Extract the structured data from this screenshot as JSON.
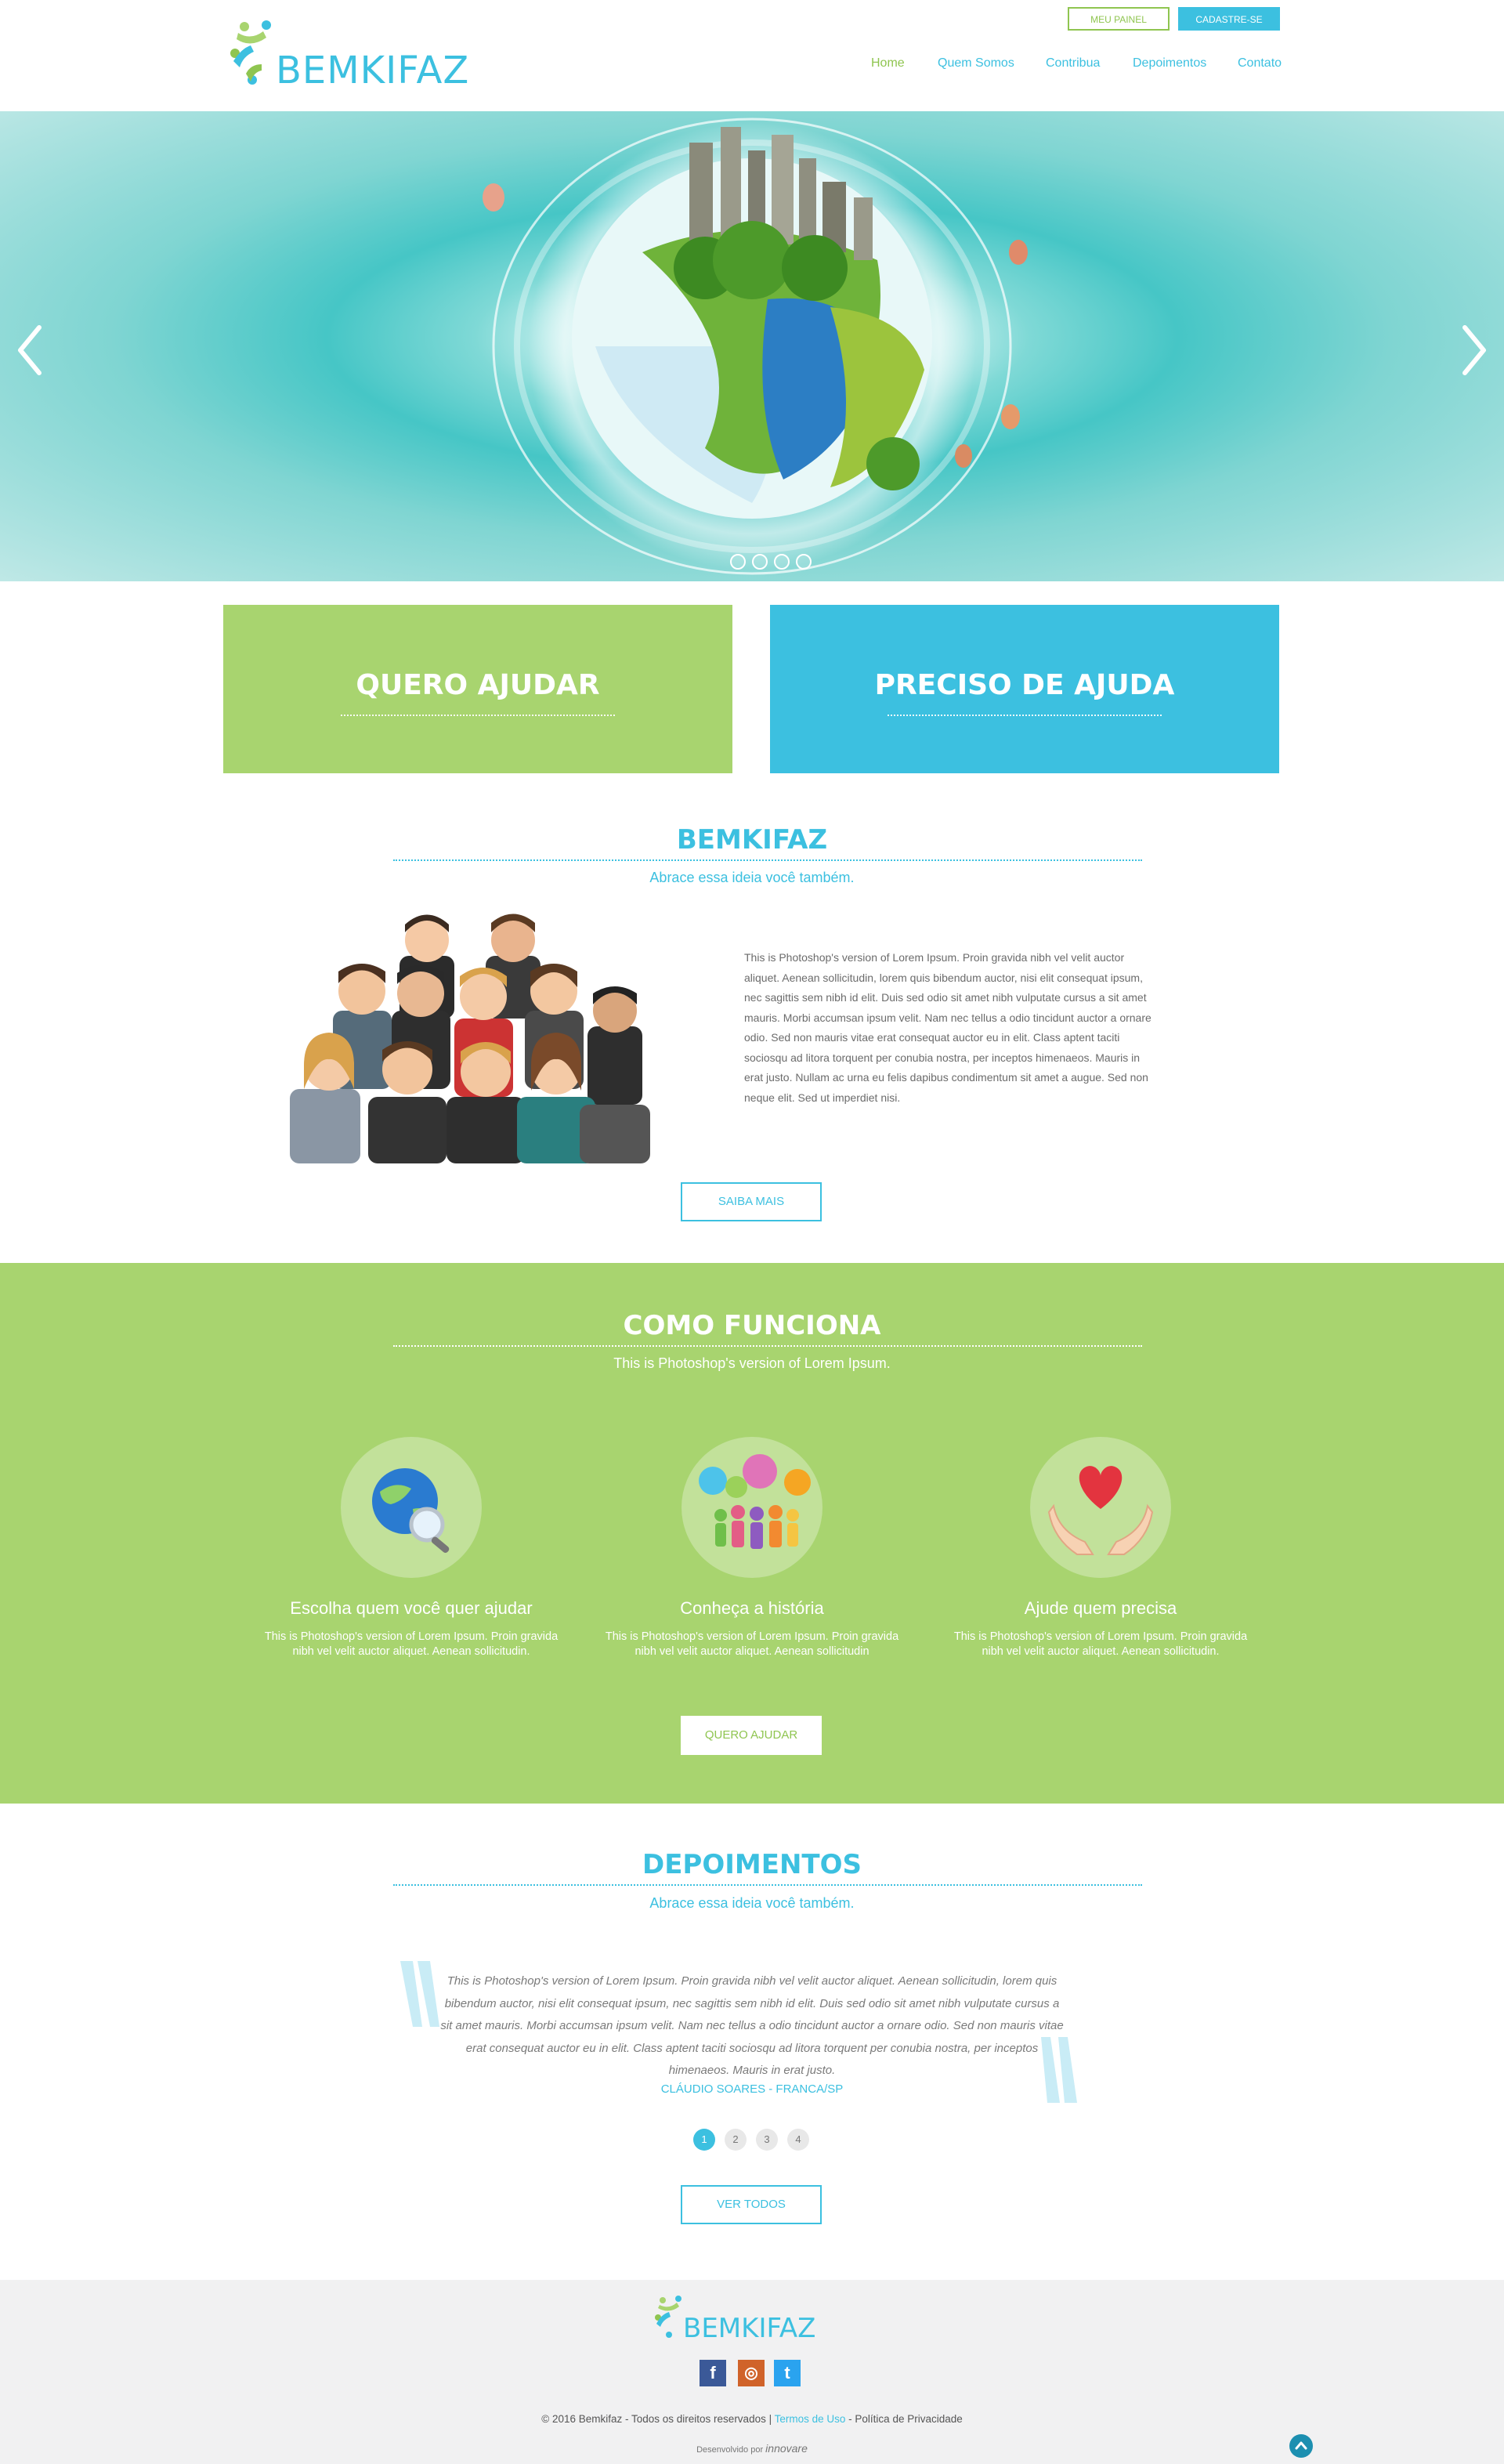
{
  "header": {
    "logo_text": "BEMKIFAZ",
    "btn_painel": "MEU PAINEL",
    "btn_cadastre": "CADASTRE-SE",
    "nav": [
      "Home",
      "Quem Somos",
      "Contribua",
      "Depoimentos",
      "Contato"
    ]
  },
  "hero": {
    "slide_count": 4,
    "active_slide": 1
  },
  "cta": {
    "help": "QUERO AJUDAR",
    "need": "PRECISO DE AJUDA"
  },
  "about": {
    "title": "BEMKIFAZ",
    "subtitle": "Abrace essa ideia você também.",
    "text": "This is Photoshop's version  of Lorem Ipsum. Proin gravida nibh vel velit auctor aliquet. Aenean sollicitudin, lorem quis bibendum auctor, nisi elit consequat ipsum, nec sagittis sem nibh id elit. Duis sed odio sit amet nibh vulputate cursus a sit amet mauris. Morbi accumsan ipsum velit. Nam nec tellus a odio tincidunt auctor a ornare odio. Sed non  mauris vitae erat consequat auctor eu in elit. Class aptent taciti sociosqu ad litora torquent per conubia nostra, per inceptos himenaeos. Mauris in erat justo. Nullam ac urna eu felis dapibus condimentum sit amet a augue. Sed non neque elit. Sed ut imperdiet nisi.",
    "button": "SAIBA MAIS"
  },
  "como": {
    "title": "COMO FUNCIONA",
    "subtitle": "This is Photoshop's version  of Lorem Ipsum.",
    "steps": [
      {
        "title": "Escolha quem você quer ajudar",
        "text": "This is Photoshop's version  of Lorem Ipsum. Proin gravida nibh vel velit auctor aliquet. Aenean sollicitudin.",
        "icon": "globe-search-icon"
      },
      {
        "title": "Conheça a história",
        "text": "This is Photoshop's version  of Lorem Ipsum. Proin gravida nibh vel velit auctor aliquet. Aenean sollicitudin",
        "icon": "people-chat-icon"
      },
      {
        "title": "Ajude quem precisa",
        "text": "This is Photoshop's version  of Lorem Ipsum. Proin gravida nibh vel velit auctor aliquet. Aenean sollicitudin.",
        "icon": "hands-heart-icon"
      }
    ],
    "button": "QUERO AJUDAR"
  },
  "depoimentos": {
    "title": "DEPOIMENTOS",
    "subtitle": "Abrace essa ideia você também.",
    "quote": "This is Photoshop's version  of Lorem Ipsum. Proin gravida nibh vel velit auctor aliquet. Aenean sollicitudin, lorem quis bibendum auctor, nisi elit consequat ipsum, nec sagittis sem nibh id elit. Duis sed odio sit amet nibh vulputate cursus a sit amet mauris. Morbi accumsan ipsum velit. Nam nec tellus a odio tincidunt auctor a ornare odio. Sed non  mauris vitae erat consequat auctor eu in elit. Class aptent taciti sociosqu ad litora torquent per conubia nostra, per inceptos himenaeos. Mauris in erat justo.",
    "author": "CLÁUDIO SOARES - FRANCA/SP",
    "pages": [
      "1",
      "2",
      "3",
      "4"
    ],
    "button": "VER TODOS"
  },
  "footer": {
    "logo_text": "BEMKIFAZ",
    "social": [
      "f",
      "◎",
      "t"
    ],
    "copyright": "© 2016 Bemkifaz - Todos os direitos reservados  |",
    "terms": "Termos de Uso",
    "privacy": "- Política de Privacidade",
    "dev_label": "Desenvolvido por",
    "dev_name": "innovare"
  },
  "colors": {
    "brand_blue": "#3cc0e0",
    "brand_green": "#a8d46f",
    "footer_bg": "#f1f1f2"
  }
}
